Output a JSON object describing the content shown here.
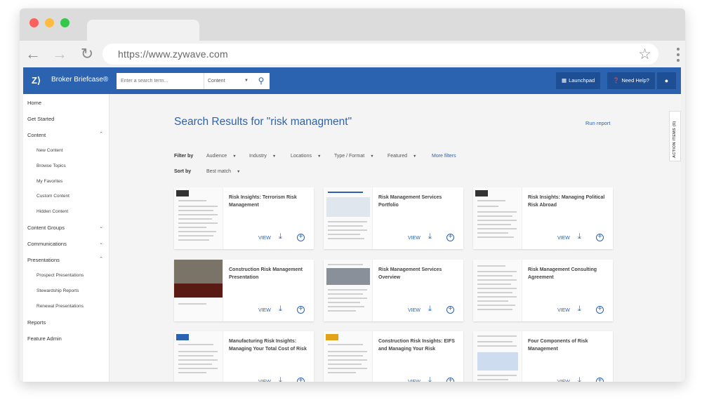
{
  "browser": {
    "url": "https://www.zywave.com",
    "traffic_colors": [
      "#fc605c",
      "#fdbc40",
      "#34c84a"
    ]
  },
  "header": {
    "logo": "Z⟩",
    "title": "Broker Briefcase®",
    "search_placeholder": "Enter a search term...",
    "search_scope": "Content",
    "launchpad": "Launchpad",
    "help": "Need Help?"
  },
  "sidebar": {
    "items": [
      {
        "label": "Home"
      },
      {
        "label": "Get Started"
      },
      {
        "label": "Content"
      },
      {
        "label": "New Content"
      },
      {
        "label": "Browse Topics"
      },
      {
        "label": "My Favorites"
      },
      {
        "label": "Custom Content"
      },
      {
        "label": "Hidden Content"
      },
      {
        "label": "Content Groups"
      },
      {
        "label": "Communications"
      },
      {
        "label": "Presentations"
      },
      {
        "label": "Prospect Presentations"
      },
      {
        "label": "Stewardship Reports"
      },
      {
        "label": "Renewal Presentations"
      },
      {
        "label": "Reports"
      },
      {
        "label": "Feature Admin"
      }
    ]
  },
  "main": {
    "title": "Search Results for \"risk managment\"",
    "run_report": "Run report",
    "action_items": "ACTION ITEMS (0)",
    "filter_by_label": "Filter by",
    "filters": [
      "Audience",
      "Industry",
      "Locations",
      "Type / Format",
      "Featured"
    ],
    "more_filters": "More filters",
    "sort_by_label": "Sort by",
    "sort_value": "Best match",
    "view_label": "VIEW",
    "cards": [
      {
        "title": "Risk Insights: Terrorism Risk Management"
      },
      {
        "title": "Risk Management Services Portfolio"
      },
      {
        "title": "Risk Insights: Managing Political Risk Abroad"
      },
      {
        "title": "Construction Risk Management Presentation"
      },
      {
        "title": "Risk Management Services Overview"
      },
      {
        "title": "Risk Management Consulting Agreement"
      },
      {
        "title": "Manufacturing Risk Insights: Managing Your Total Cost of Risk"
      },
      {
        "title": "Construction Risk Insights: EIFS and Managing Your Risk"
      },
      {
        "title": "Four Components of Risk Management"
      }
    ]
  },
  "colors": {
    "brand": "#2b63b0",
    "header_button": "#1e4f95"
  }
}
